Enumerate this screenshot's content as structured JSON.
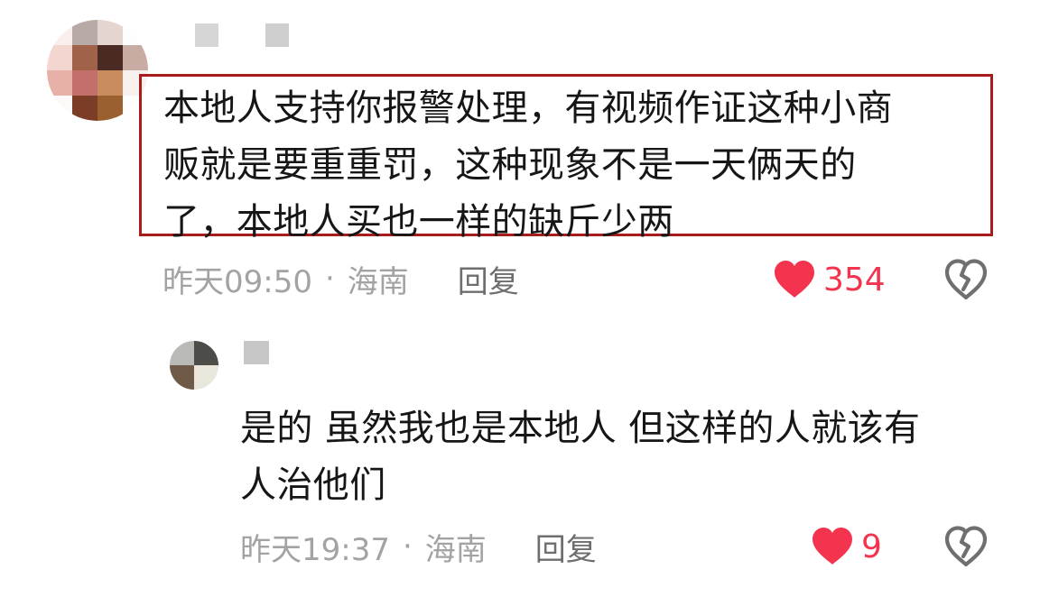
{
  "colors": {
    "highlight_border": "#a81c1c",
    "like_red": "#f4344f",
    "meta_grey": "#a3a3a3",
    "reply_grey": "#6e6e6e",
    "dislike_grey": "#6f6f6f"
  },
  "comments": [
    {
      "avatar_pixels": [
        "#fbefed",
        "#b8aba7",
        "#e4d5cf",
        "#fdfdfd",
        "#f4d6d0",
        "#a0634a",
        "#4a2a22",
        "#c8aba2",
        "#e8b1a8",
        "#c36f6a",
        "#c98c5e",
        "#f9f1ee",
        "#fdf9f8",
        "#7c3d27",
        "#9a6030",
        "#fdfdfd"
      ],
      "username_blocks": [
        "#d6d6d6",
        "#ffffff",
        "#ffffff",
        "#cfcfcf"
      ],
      "text": "本地人支持你报警处理，有视频作证这种小商\n贩就是要重重罚，这种现象不是一天俩天的\n了，本地人买也一样的缺斤少两",
      "time": "昨天09:50",
      "location": "海南",
      "reply_label": "回复",
      "like_count": "354",
      "like_icon": "heart-icon",
      "dislike_icon": "broken-heart-icon",
      "highlighted": true
    },
    {
      "avatar_pixels": [
        "#b9b9b5",
        "#4c4c48",
        "#6f5a47",
        "#e9e7dc"
      ],
      "username_blocks": [
        "#c7c7c7",
        "#ffffff"
      ],
      "text": "是的 虽然我也是本地人 但这样的人就该有\n人治他们",
      "time": "昨天19:37",
      "location": "海南",
      "reply_label": "回复",
      "like_count": "9",
      "like_icon": "heart-icon",
      "dislike_icon": "broken-heart-icon",
      "highlighted": false
    }
  ]
}
